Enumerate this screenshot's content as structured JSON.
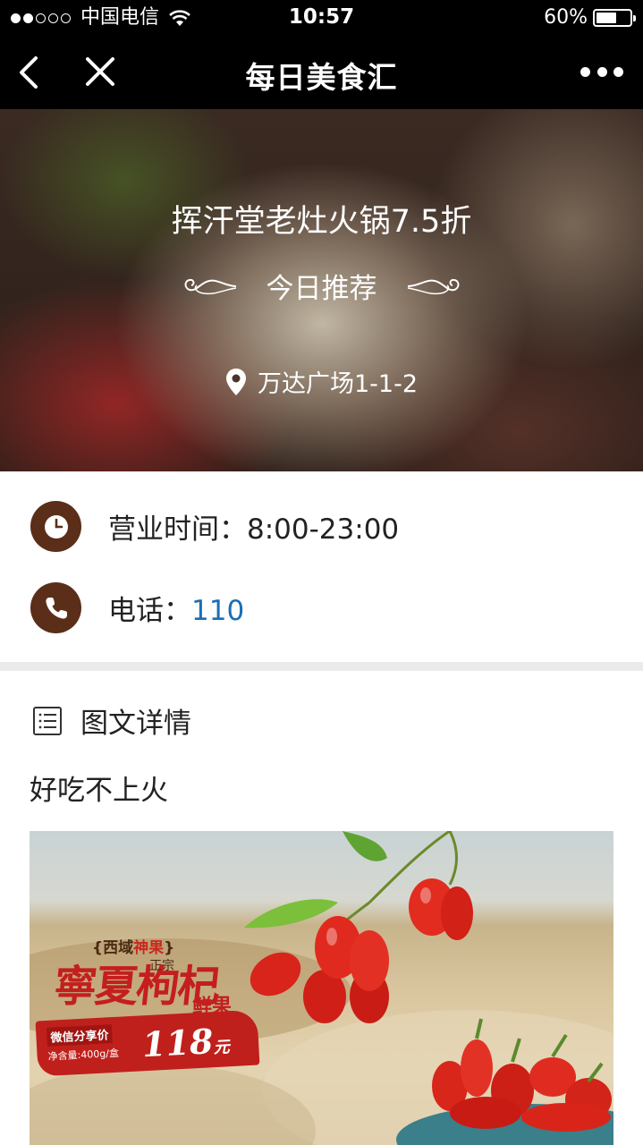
{
  "status_bar": {
    "carrier": "中国电信",
    "time": "10:57",
    "battery": "60%",
    "signal_bars_filled": 2,
    "signal_bars_total": 5,
    "battery_level": 0.6
  },
  "nav": {
    "title": "每日美食汇"
  },
  "hero": {
    "title": "挥汗堂老灶火锅7.5折",
    "subtitle": "今日推荐",
    "location": "万达广场1-1-2"
  },
  "info": {
    "hours_label": "营业时间：",
    "hours_value": "8:00-23:00",
    "phone_label": "电话：",
    "phone_value": "110"
  },
  "details": {
    "title": "图文详情",
    "text": "好吃不上火"
  },
  "banner": {
    "brand_left": "{西域",
    "brand_red": "神果",
    "brand_right": "}",
    "zhengzong": "正宗",
    "title": "寧夏枸杞",
    "fresh": "鲜果",
    "price_label": "微信分享价",
    "weight": "净含量:400g/盒",
    "price": "118",
    "price_unit": "元"
  },
  "colors": {
    "icon_brown": "#5a2e18",
    "link_blue": "#1a6eb5",
    "divider": "#ebebeb"
  }
}
